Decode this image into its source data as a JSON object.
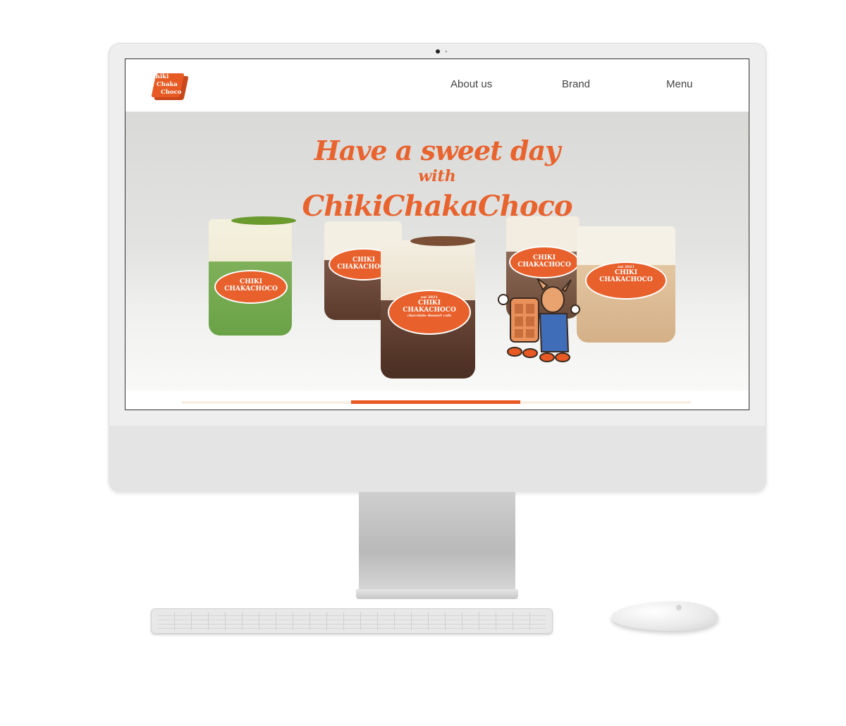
{
  "site": {
    "logo_lines": [
      "Chiki",
      "Chaka",
      "Choco"
    ],
    "nav": {
      "about": "About us",
      "brand": "Brand",
      "menu": "Menu"
    },
    "hero": {
      "line1": "Have a sweet day",
      "line2": "with",
      "line3": "ChikiChakaChoco"
    },
    "cup_label": {
      "est": "est 2021",
      "name_line1": "CHIKI",
      "name_line2": "CHAKACHOCO",
      "sub": "chocolate dessert cafe"
    },
    "slider_progress": 0.333
  },
  "colors": {
    "brand_orange": "#e85a23",
    "nav_text": "#444444"
  },
  "icons": [
    "camera-icon",
    "apple-logo-icon"
  ]
}
